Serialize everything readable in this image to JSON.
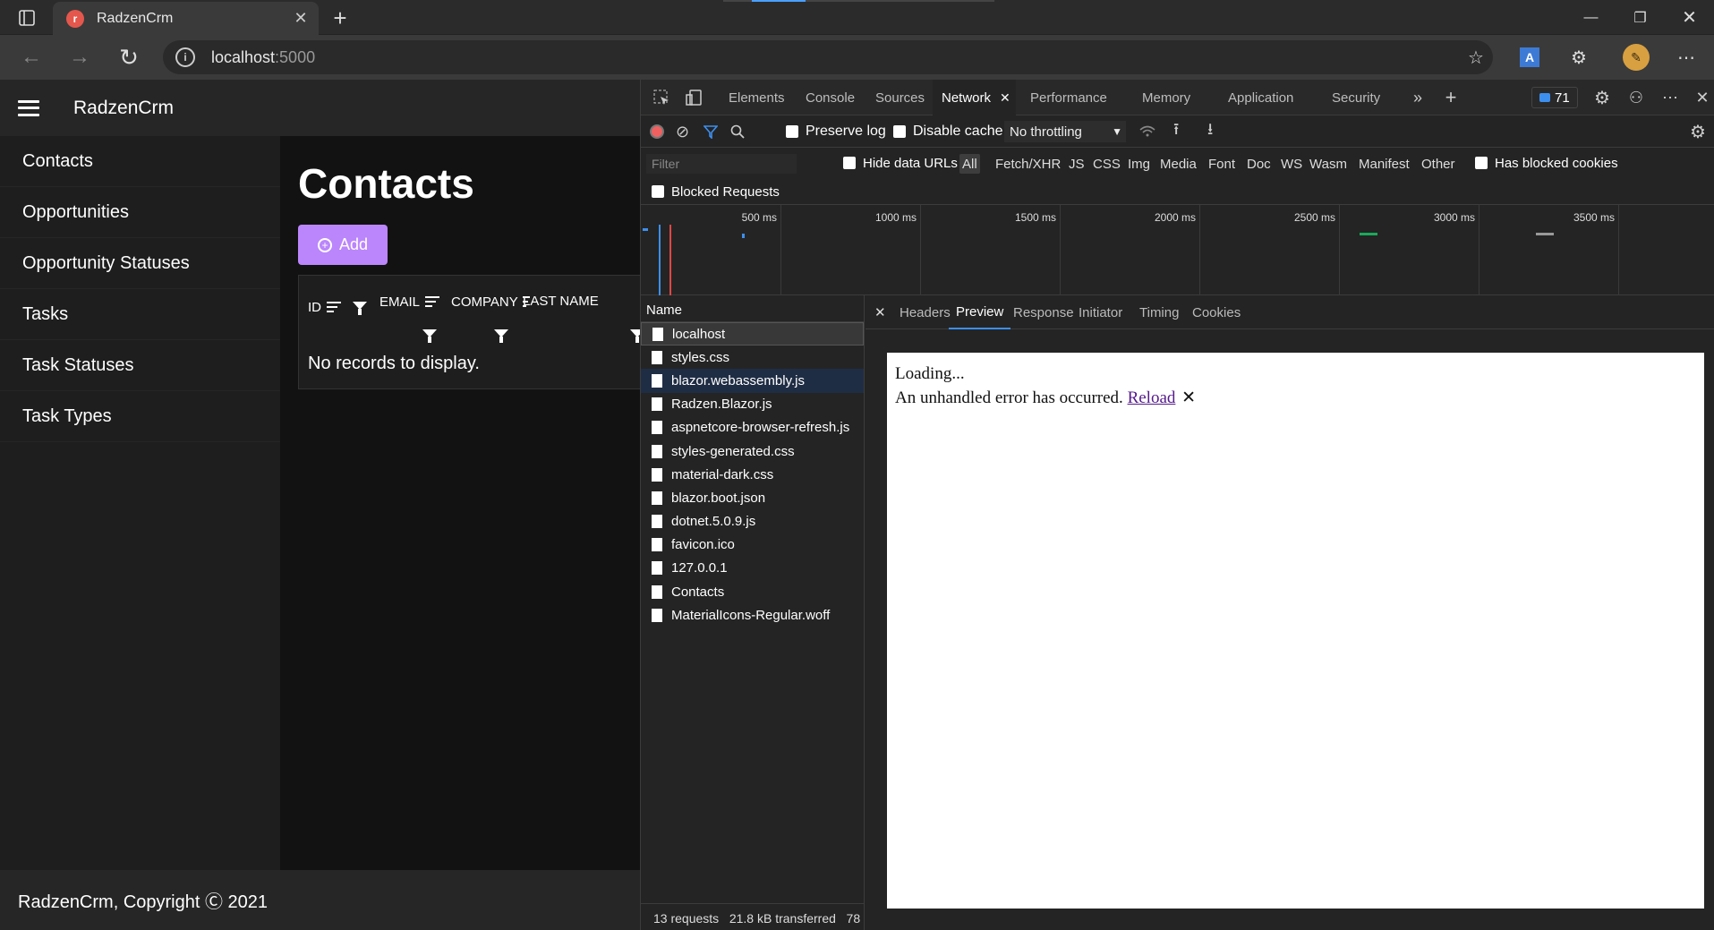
{
  "browser": {
    "tab_title": "RadzenCrm",
    "url_host": "localhost",
    "url_port": ":5000"
  },
  "app": {
    "name": "RadzenCrm",
    "nav": [
      "Contacts",
      "Opportunities",
      "Opportunity Statuses",
      "Tasks",
      "Task Statuses",
      "Task Types"
    ],
    "page_title": "Contacts",
    "add_label": "Add",
    "columns": [
      "ID",
      "EMAIL",
      "COMPANY",
      "LAST NAME"
    ],
    "empty_message": "No records to display.",
    "footer": "RadzenCrm, Copyright Ⓒ 2021"
  },
  "devtools": {
    "tabs": [
      "Elements",
      "Console",
      "Sources",
      "Network",
      "Performance",
      "Memory",
      "Application",
      "Security"
    ],
    "issues_count": "71",
    "preserve_log": "Preserve log",
    "disable_cache": "Disable cache",
    "throttling": "No throttling",
    "filter_placeholder": "Filter",
    "hide_data_urls": "Hide data URLs",
    "filter_types": [
      "All",
      "Fetch/XHR",
      "JS",
      "CSS",
      "Img",
      "Media",
      "Font",
      "Doc",
      "WS",
      "Wasm",
      "Manifest",
      "Other"
    ],
    "has_blocked_cookies": "Has blocked cookies",
    "blocked_requests": "Blocked Requests",
    "timeline_ticks": [
      "500 ms",
      "1000 ms",
      "1500 ms",
      "2000 ms",
      "2500 ms",
      "3000 ms",
      "3500 ms"
    ],
    "name_header": "Name",
    "requests": [
      "localhost",
      "styles.css",
      "blazor.webassembly.js",
      "Radzen.Blazor.js",
      "aspnetcore-browser-refresh.js",
      "styles-generated.css",
      "material-dark.css",
      "blazor.boot.json",
      "dotnet.5.0.9.js",
      "favicon.ico",
      "127.0.0.1",
      "Contacts",
      "MaterialIcons-Regular.woff"
    ],
    "status_bar": "13 requests   21.8 kB transferred   78",
    "detail_tabs": [
      "Headers",
      "Preview",
      "Response",
      "Initiator",
      "Timing",
      "Cookies"
    ],
    "preview": {
      "loading": "Loading...",
      "error": "An unhandled error has occurred.",
      "reload": "Reload",
      "dismiss": "✕"
    }
  }
}
